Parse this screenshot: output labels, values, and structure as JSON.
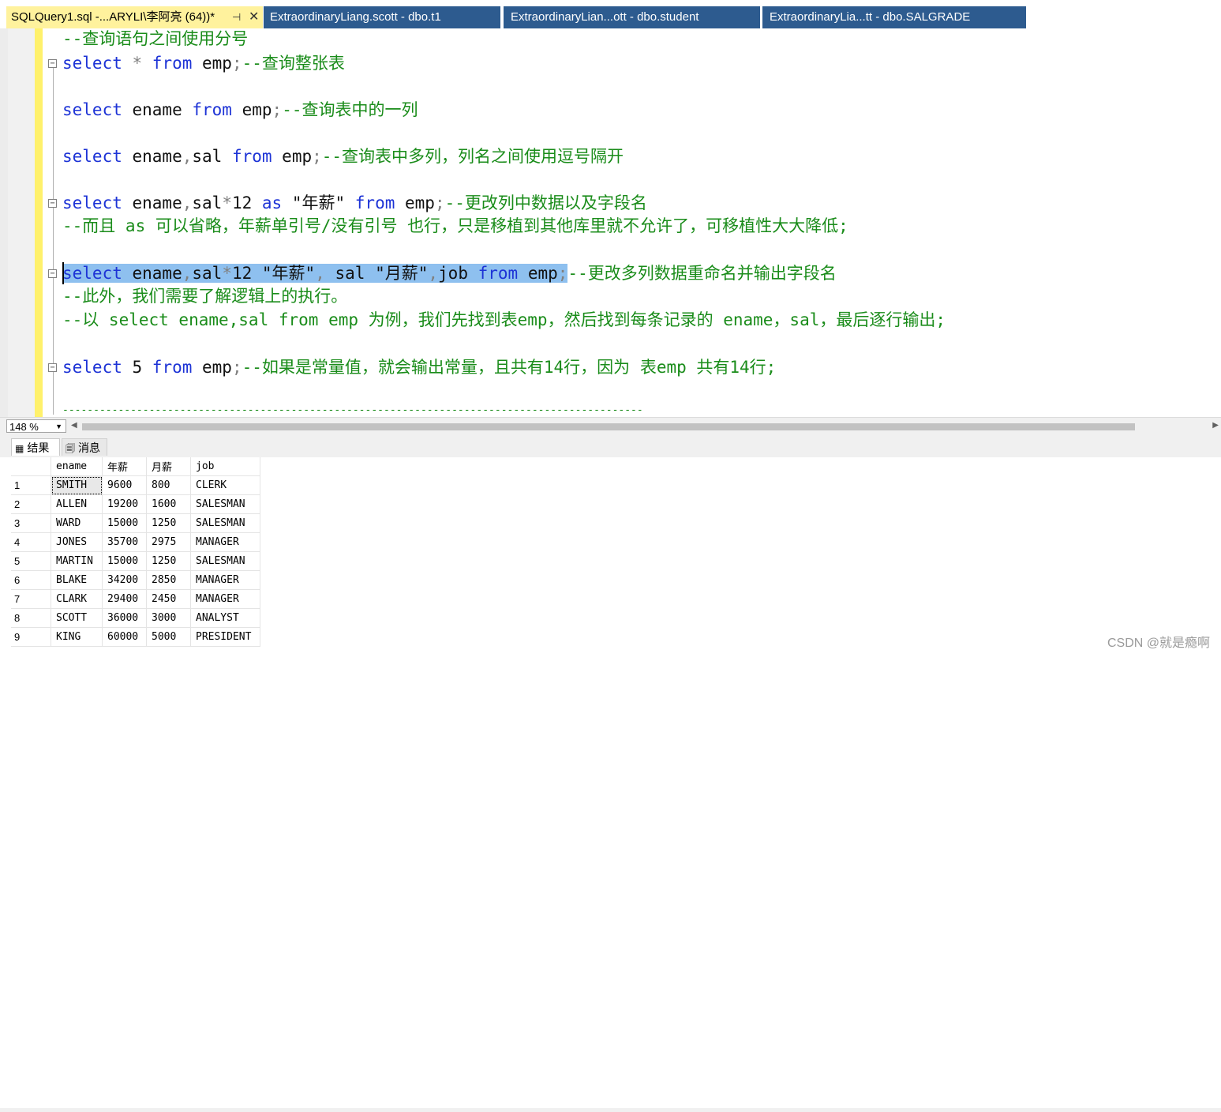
{
  "tabs": [
    {
      "label": "SQLQuery1.sql -...ARYLI\\李阿亮 (64))*",
      "active": true
    },
    {
      "label": "ExtraordinaryLiang.scott - dbo.t1",
      "active": false
    },
    {
      "label": "ExtraordinaryLian...ott - dbo.student",
      "active": false
    },
    {
      "label": "ExtraordinaryLia...tt - dbo.SALGRADE",
      "active": false
    }
  ],
  "tab_icons": {
    "pin": "pin-icon",
    "close": "close-icon"
  },
  "editor": {
    "lines": {
      "l1": {
        "c": "--查询语句之间使用分号"
      },
      "l2": {
        "k1": "select",
        "o1": " * ",
        "k2": "from",
        "t1": " emp",
        "o2": ";",
        "c": "--查询整张表"
      },
      "l3": {
        "k1": "select",
        "t1": " ename ",
        "k2": "from",
        "t2": " emp",
        "o1": ";",
        "c": "--查询表中的一列"
      },
      "l4": {
        "k1": "select",
        "t1": " ename",
        "o1": ",",
        "t2": "sal ",
        "k2": "from",
        "t3": " emp",
        "o2": ";",
        "c": "--查询表中多列，列名之间使用逗号隔开"
      },
      "l5": {
        "k1": "select",
        "t1": " ename",
        "o1": ",",
        "t2": "sal",
        "o2": "*",
        "t3": "12 ",
        "k2": "as",
        "s1": " \"年薪\" ",
        "k3": "from",
        "t4": " emp",
        "o3": ";",
        "c": "--更改列中数据以及字段名"
      },
      "l6": {
        "c": "--而且 as 可以省略，年薪单引号/没有引号 也行，只是移植到其他库里就不允许了，可移植性大大降低;"
      },
      "l7": {
        "k1": "select",
        "t1": " ename",
        "o1": ",",
        "t2": "sal",
        "o2": "*",
        "t3": "12 ",
        "s1": "\"年薪\"",
        "o3": ", ",
        "t4": "sal ",
        "s2": "\"月薪\"",
        "o4": ",",
        "t5": "job ",
        "k2": "from",
        "t6": " emp",
        "o5": ";",
        "c": "--更改多列数据重命名并输出字段名"
      },
      "l8": {
        "c": "--此外，我们需要了解逻辑上的执行。"
      },
      "l9": {
        "c": "--以 select ename,sal from emp 为例，我们先找到表emp，然后找到每条记录的 ename，sal，最后逐行输出;"
      },
      "l10": {
        "k1": "select",
        "t1": " 5 ",
        "k2": "from",
        "t2": " emp",
        "o1": ";",
        "c": "--如果是常量值，就会输出常量，且共有14行，因为 表emp 共有14行;"
      },
      "l11": {
        "c": "----------------------------------------------------------------------------------------------"
      }
    }
  },
  "zoom": {
    "value": "148 %"
  },
  "results_tabs": [
    {
      "label": "结果",
      "icon": "grid-icon"
    },
    {
      "label": "消息",
      "icon": "message-icon"
    }
  ],
  "grid": {
    "columns": [
      "ename",
      "年薪",
      "月薪",
      "job"
    ],
    "rows": [
      {
        "n": "1",
        "ename": "SMITH",
        "y": "9600",
        "m": "800",
        "job": "CLERK"
      },
      {
        "n": "2",
        "ename": "ALLEN",
        "y": "19200",
        "m": "1600",
        "job": "SALESMAN"
      },
      {
        "n": "3",
        "ename": "WARD",
        "y": "15000",
        "m": "1250",
        "job": "SALESMAN"
      },
      {
        "n": "4",
        "ename": "JONES",
        "y": "35700",
        "m": "2975",
        "job": "MANAGER"
      },
      {
        "n": "5",
        "ename": "MARTIN",
        "y": "15000",
        "m": "1250",
        "job": "SALESMAN"
      },
      {
        "n": "6",
        "ename": "BLAKE",
        "y": "34200",
        "m": "2850",
        "job": "MANAGER"
      },
      {
        "n": "7",
        "ename": "CLARK",
        "y": "29400",
        "m": "2450",
        "job": "MANAGER"
      },
      {
        "n": "8",
        "ename": "SCOTT",
        "y": "36000",
        "m": "3000",
        "job": "ANALYST"
      },
      {
        "n": "9",
        "ename": "KING",
        "y": "60000",
        "m": "5000",
        "job": "PRESIDENT"
      }
    ]
  },
  "watermark": "CSDN @就是瘾啊"
}
